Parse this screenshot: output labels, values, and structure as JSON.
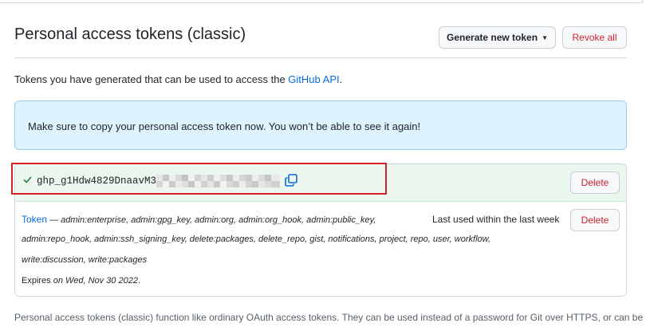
{
  "header": {
    "title": "Personal access tokens (classic)",
    "generate_button": "Generate new token",
    "generate_caret_icon": "triangle-down-icon",
    "revoke_button": "Revoke all"
  },
  "intro": {
    "text": "Tokens you have generated that can be used to access the ",
    "link": "GitHub API",
    "suffix": "."
  },
  "flash": {
    "message": "Make sure to copy your personal access token now. You won’t be able to see it again!"
  },
  "new_token": {
    "status_icon": "check-icon",
    "value_visible": "ghp_g1Hdw4829DnaavM3",
    "value_redacted": true,
    "copy_icon": "copy-icon",
    "delete_button": "Delete",
    "highlight_color": "#d6212c"
  },
  "token_entry": {
    "name": "Token",
    "separator": " — ",
    "scopes_line1": "admin:enterprise, admin:gpg_key, admin:org, admin:org_hook, admin:public_key,",
    "scopes_line2": "admin:repo_hook, admin:ssh_signing_key, delete:packages, delete_repo, gist, notifications, project, repo, user, workflow,",
    "scopes_line3": "write:discussion, write:packages",
    "last_used": "Last used within the last week",
    "expires_prefix": "Expires ",
    "expires_date": "on Wed, Nov 30 2022",
    "expires_suffix": ".",
    "delete_button": "Delete"
  },
  "footer": {
    "text": "Personal access tokens (classic) function like ordinary OAuth access tokens. They can be used instead of a password for Git over HTTPS, or can be"
  },
  "colors": {
    "link": "#0969da",
    "danger": "#cf222e",
    "flash_bg": "#ddf4ff",
    "new_token_bg": "#ebf6ee",
    "success": "#1a7f37"
  }
}
